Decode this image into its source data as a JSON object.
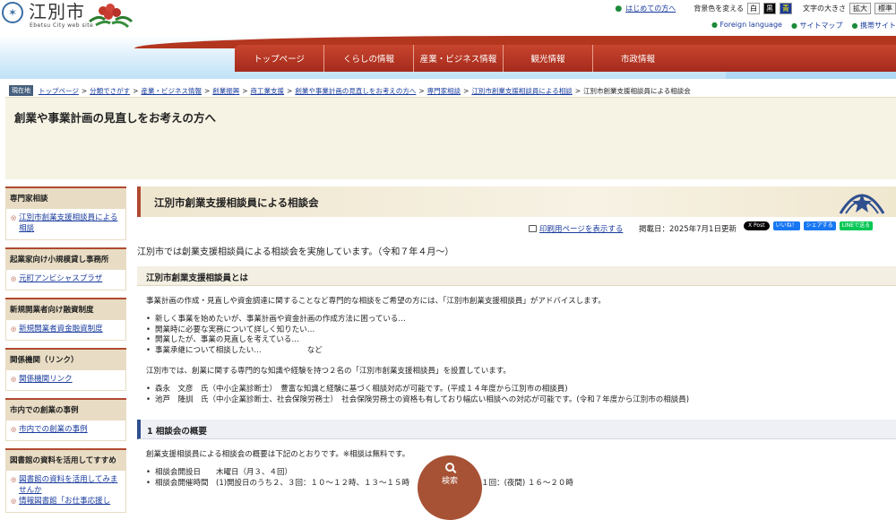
{
  "header": {
    "site_name": "江別市",
    "site_sub": "Ebetsu City web site",
    "first_time": "はじめての方へ",
    "bg_color_label": "背景色を変える",
    "color_options": [
      "白",
      "黒",
      "青"
    ],
    "font_size_label": "文字の大きさ",
    "font_sizes": [
      "拡大",
      "標準"
    ],
    "foreign_language": "Foreign language",
    "sitemap": "サイトマップ",
    "mobile_site": "携帯サイト"
  },
  "nav": [
    "トップページ",
    "くらしの情報",
    "産業・ビジネス情報",
    "観光情報",
    "市政情報"
  ],
  "breadcrumb": {
    "here": "現在地",
    "items": [
      "トップページ",
      "分類でさがす",
      "産業・ビジネス情報",
      "創業振興",
      "商工業支援",
      "創業や事業計画の見直しをお考えの方へ",
      "専門家相談",
      "江別市創業支援相談員による相談"
    ],
    "current": "江別市創業支援相談員による相談会"
  },
  "page_title": "創業や事業計画の見直しをお考えの方へ",
  "sidebar": [
    {
      "heading": "専門家相談",
      "links": [
        "江別市創業支援相談員による相談"
      ]
    },
    {
      "heading": "起業家向け小規模貸し事務所",
      "links": [
        "元町アンビシャスプラザ"
      ]
    },
    {
      "heading": "新規開業者向け融資制度",
      "links": [
        "新規開業者資金融資制度"
      ]
    },
    {
      "heading": "関係機関（リンク）",
      "links": [
        "関係機関リンク"
      ]
    },
    {
      "heading": "市内での創業の事例",
      "links": [
        "市内での創業の事例"
      ]
    },
    {
      "heading": "図書館の資料を活用してすすめ",
      "links": [
        "図書館の資料を活用してみませんか",
        "情報図書館「お仕事応援し"
      ]
    }
  ],
  "main": {
    "heading": "江別市創業支援相談員による相談会",
    "print_link": "印刷用ページを表示する",
    "published": "掲載日：2025年7月1日更新",
    "social": [
      "X Post",
      "いいね！",
      "シェアする",
      "LINEで送る"
    ],
    "lead": "江別市では創業支援相談員による相談会を実施しています。（令和７年４月〜）",
    "section1_title": "江別市創業支援相談員とは",
    "section1_para": "事業計画の作成・見直しや資金調達に関することなど専門的な相談をご希望の方には、「江別市創業支援相談員」がアドバイスします。",
    "section1_bullets": [
      "新しく事業を始めたいが、事業計画や資金計画の作成方法に困っている…",
      "開業時に必要な実務について詳しく知りたい…",
      "開業したが、事業の見直しを考えている…",
      "事業承継について相談したい…　　　　　　など"
    ],
    "section1_para2": "江別市では、創業に関する専門的な知識や経験を持つ２名の「江別市創業支援相談員」を設置しています。",
    "consultants": [
      "森永　文彦　氏（中小企業診断士）　豊富な知識と経験に基づく相談対応が可能です。(平成１４年度から江別市の相談員)",
      "池芦　隆訓　氏（中小企業診断士、社会保険労務士）　社会保険労務士の資格も有しており幅広い相談への対応が可能です。(令和７年度から江別市の相談員)"
    ],
    "section2_title": "1  相談会の概要",
    "section2_para": "創業支援相談員による相談会の概要は下記のとおりです。※相談は無料です。",
    "section2_bullets": [
      "相談会開設日　　木曜日（月３、４回）",
      "相談会開催時間　(1)開設日のうち２、３回：１０〜１２時、１３〜１５時　　(2)開設日のうち１回：(夜間) １６〜２０時"
    ],
    "search_label": "検索"
  }
}
